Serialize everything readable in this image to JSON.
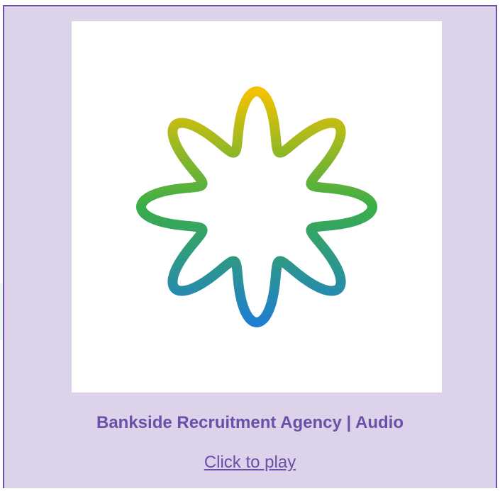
{
  "card": {
    "title": "Bankside Recruitment Agency | Audio",
    "link_label": "Click to play"
  },
  "artwork": {
    "icon": "star-knot-logo-icon",
    "gradient_top": "#f2c200",
    "gradient_mid": "#3aae48",
    "gradient_bottom": "#1f7fd0"
  },
  "colors": {
    "card_background": "#dcd2ea",
    "accent": "#6b4fa8"
  }
}
